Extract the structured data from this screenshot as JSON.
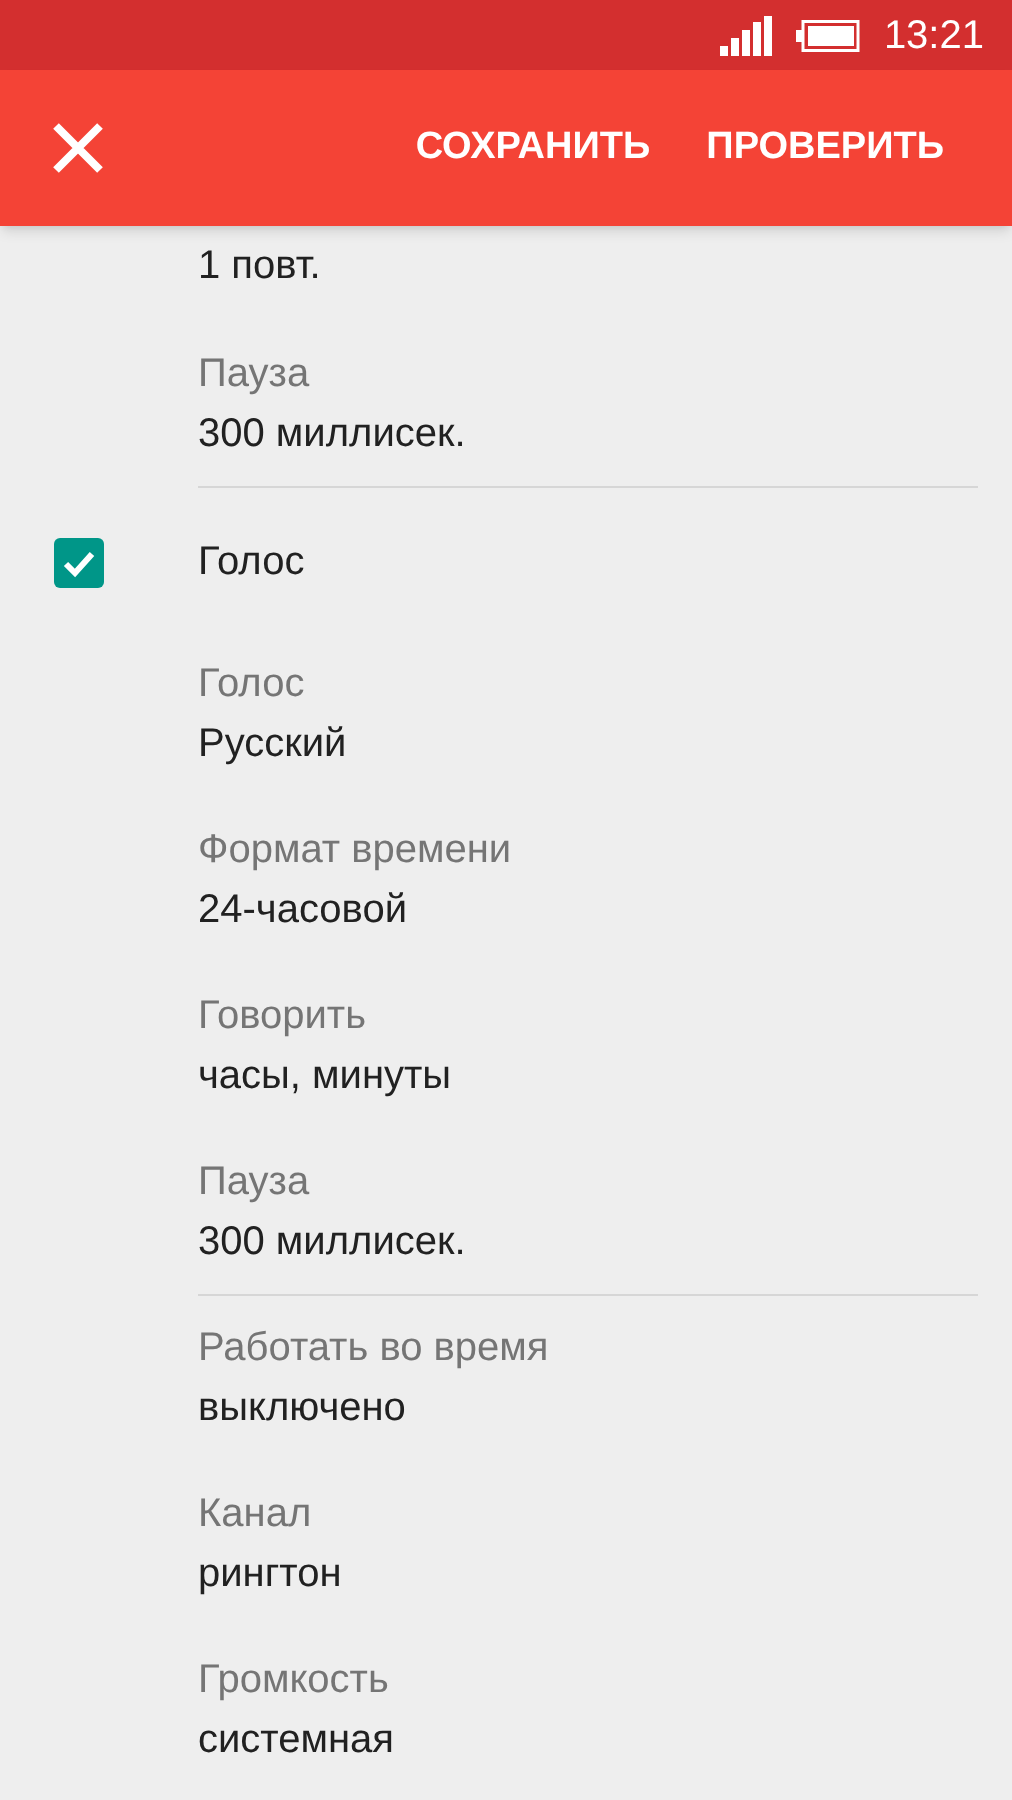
{
  "status_bar": {
    "time": "13:21"
  },
  "toolbar": {
    "actions": [
      "СОХРАНИТЬ",
      "ПРОВЕРИТЬ"
    ]
  },
  "items": [
    {
      "kind": "value",
      "value": "1 повт."
    },
    {
      "kind": "setting",
      "title": "Пауза",
      "value": "300 миллисек."
    },
    {
      "kind": "divider"
    },
    {
      "kind": "checkbox",
      "label": "Голос",
      "checked": true
    },
    {
      "kind": "setting",
      "title": "Голос",
      "value": "Русский"
    },
    {
      "kind": "setting",
      "title": "Формат времени",
      "value": "24-часовой"
    },
    {
      "kind": "setting",
      "title": "Говорить",
      "value": "часы, минуты"
    },
    {
      "kind": "setting",
      "title": "Пауза",
      "value": "300 миллисек."
    },
    {
      "kind": "divider"
    },
    {
      "kind": "setting",
      "title": "Работать во время",
      "value": "выключено"
    },
    {
      "kind": "setting",
      "title": "Канал",
      "value": "рингтон"
    },
    {
      "kind": "setting",
      "title": "Громкость",
      "value": "системная"
    }
  ]
}
